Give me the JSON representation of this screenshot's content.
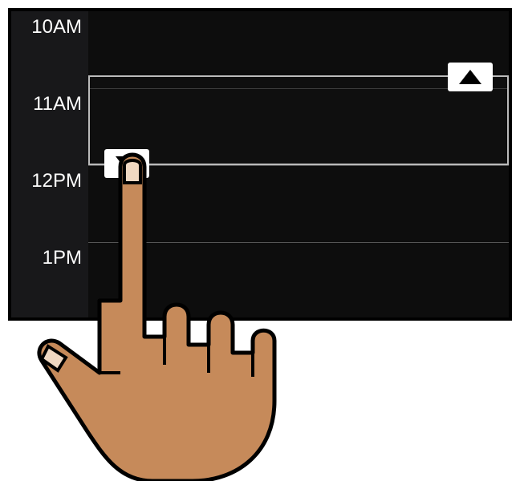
{
  "calendar": {
    "time_labels": [
      "10AM",
      "11AM",
      "12PM",
      "1PM"
    ],
    "event": {
      "start_label": "11AM",
      "end_label": "12PM"
    },
    "handles": {
      "up_icon": "triangle-up",
      "down_icon": "triangle-down"
    }
  }
}
